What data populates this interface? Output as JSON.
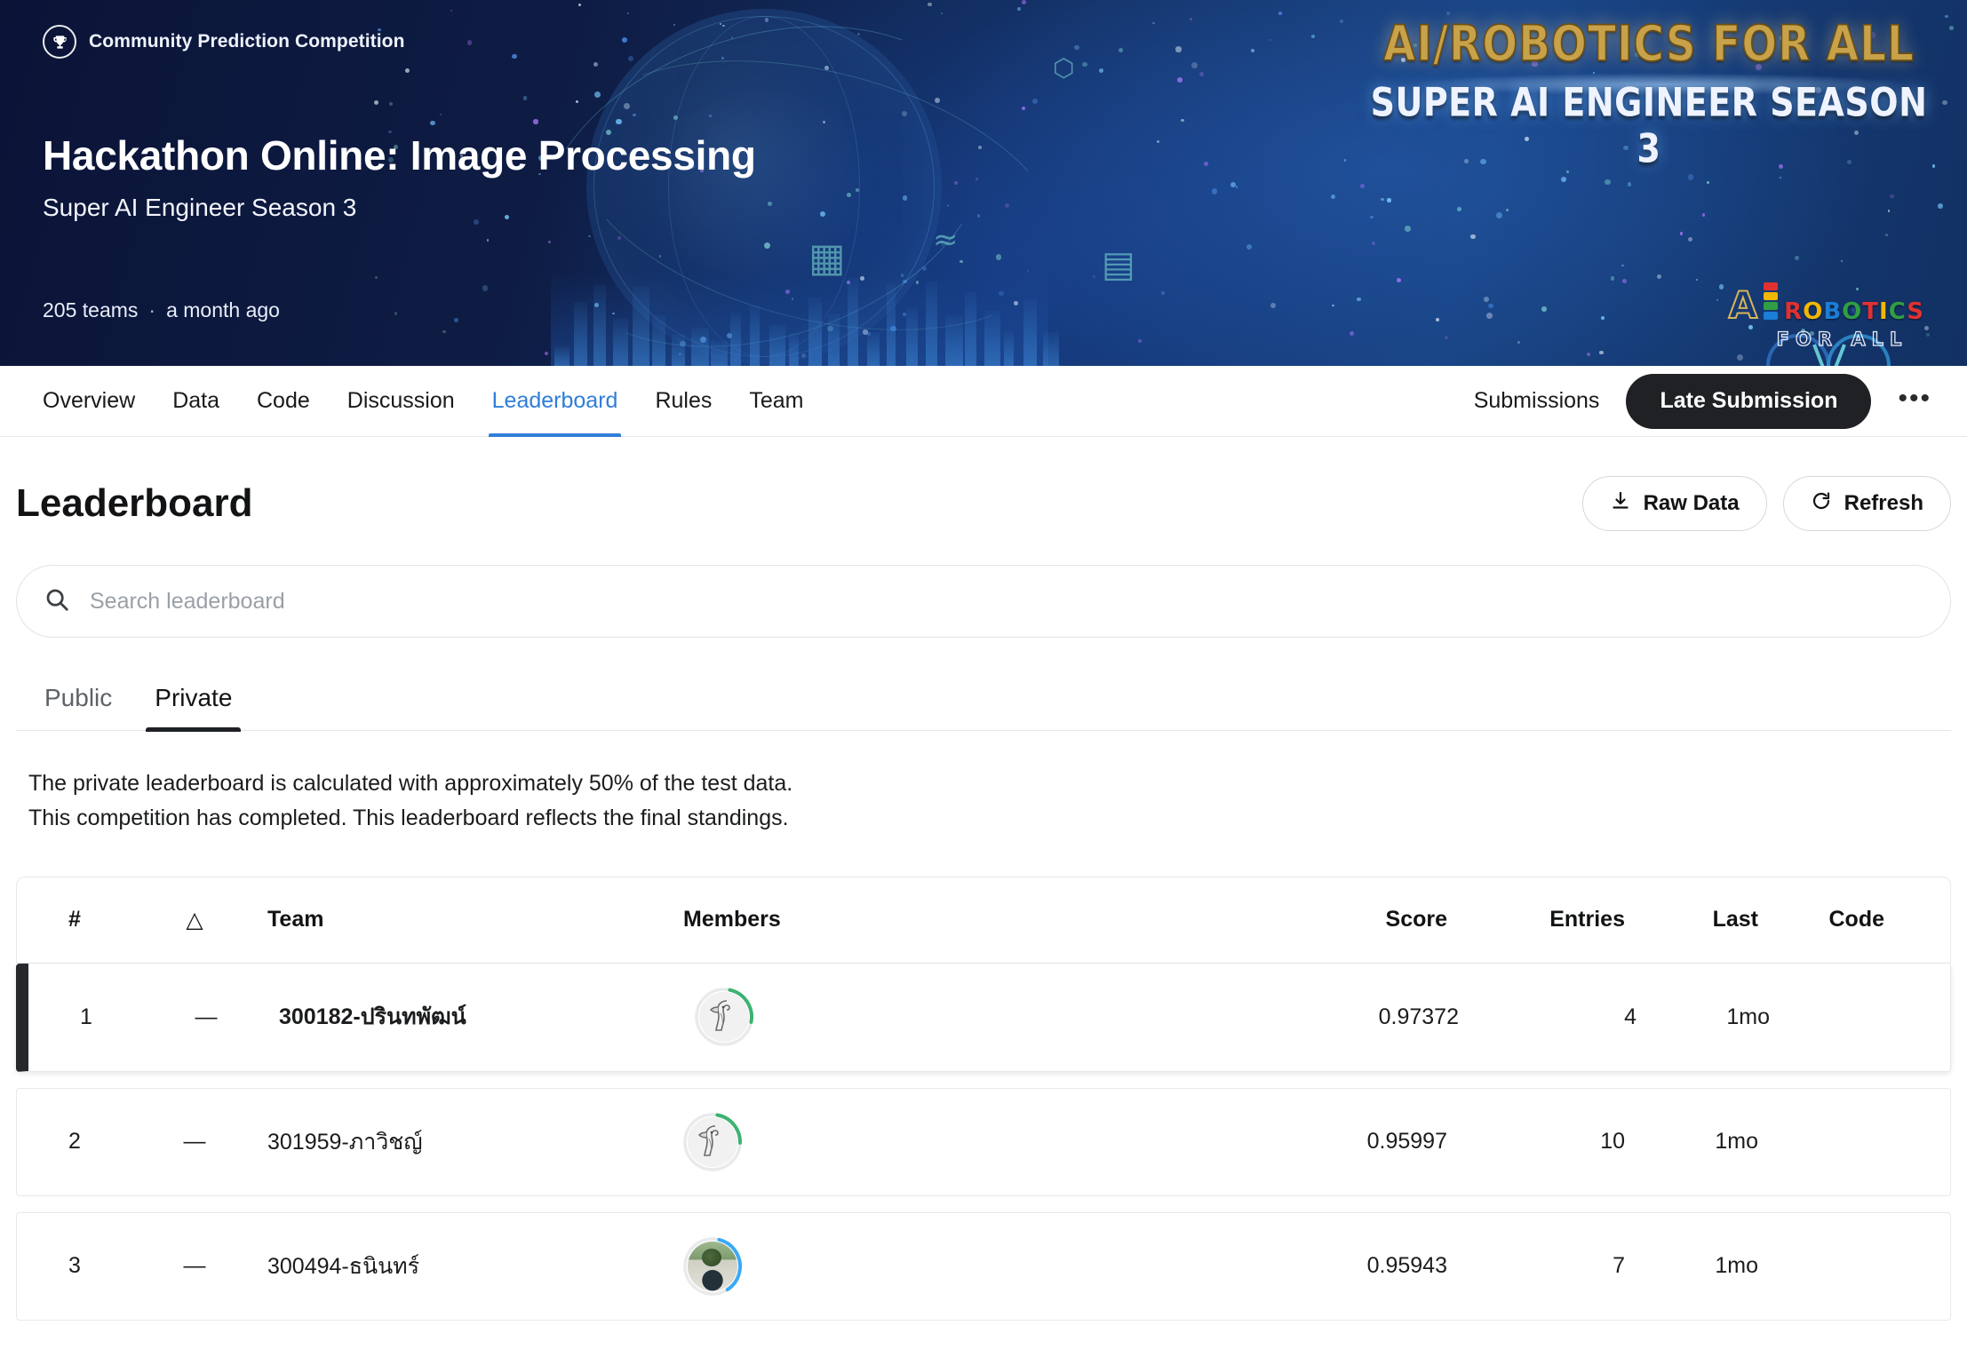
{
  "banner": {
    "badge_label": "Community Prediction Competition",
    "badge_icon": "trophy-icon",
    "title": "Hackathon Online: Image Processing",
    "subtitle": "Super AI Engineer Season 3",
    "teams_count": "205 teams",
    "separator": "·",
    "age": "a month ago",
    "promo_line1": "AI/ROBOTICS FOR ALL",
    "promo_line2": "SUPER AI ENGINEER SEASON 3",
    "logo": {
      "a": "A",
      "robotics": "ROBOTICS",
      "for_all": "FOR ALL",
      "colors": [
        "#e03131",
        "#f2b705",
        "#2f9e44",
        "#1c7ed6"
      ]
    }
  },
  "nav": {
    "tabs": [
      {
        "label": "Overview",
        "active": false
      },
      {
        "label": "Data",
        "active": false
      },
      {
        "label": "Code",
        "active": false
      },
      {
        "label": "Discussion",
        "active": false
      },
      {
        "label": "Leaderboard",
        "active": true
      },
      {
        "label": "Rules",
        "active": false
      },
      {
        "label": "Team",
        "active": false
      }
    ],
    "submissions_label": "Submissions",
    "late_submission_label": "Late Submission",
    "more_label": "•••",
    "accent_color": "#2f7ed8"
  },
  "leaderboard": {
    "title": "Leaderboard",
    "raw_data_label": "Raw Data",
    "refresh_label": "Refresh",
    "search_placeholder": "Search leaderboard",
    "search_value": "",
    "tabs": [
      {
        "label": "Public",
        "active": false
      },
      {
        "label": "Private",
        "active": true
      }
    ],
    "notice_line1": "The private leaderboard is calculated with approximately 50% of the test data.",
    "notice_line2": "This competition has completed. This leaderboard reflects the final standings.",
    "columns": {
      "rank": "#",
      "delta": "△",
      "team": "Team",
      "members": "Members",
      "score": "Score",
      "entries": "Entries",
      "last": "Last",
      "code": "Code"
    },
    "rows": [
      {
        "rank": "1",
        "delta": "—",
        "team": "300182-ปรินทพัฒน์",
        "avatar": "goose-avatar",
        "ring_color": "#3cb371",
        "score": "0.97372",
        "entries": "4",
        "last": "1mo",
        "code": "",
        "highlighted": true
      },
      {
        "rank": "2",
        "delta": "—",
        "team": "301959-ภาวิชญ์",
        "avatar": "goose-avatar",
        "ring_color": "#3cb371",
        "score": "0.95997",
        "entries": "10",
        "last": "1mo",
        "code": "",
        "highlighted": false
      },
      {
        "rank": "3",
        "delta": "—",
        "team": "300494-ธนินทร์",
        "avatar": "photo-avatar",
        "ring_color": "#3ba9f5",
        "score": "0.95943",
        "entries": "7",
        "last": "1mo",
        "code": "",
        "highlighted": false
      }
    ]
  }
}
